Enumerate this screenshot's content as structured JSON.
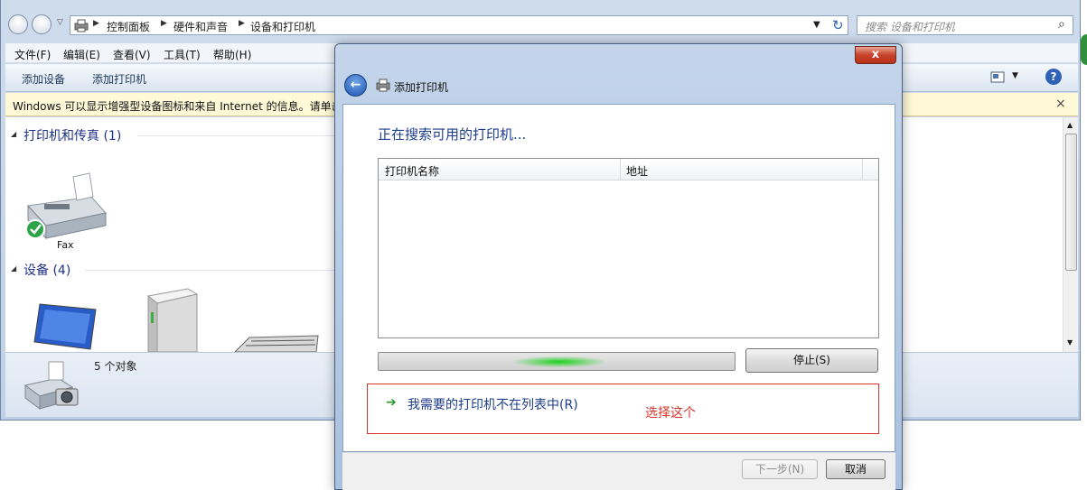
{
  "explorer": {
    "breadcrumbs": [
      "控制面板",
      "硬件和声音",
      "设备和打印机"
    ],
    "search_placeholder": "搜索 设备和打印机",
    "menu": [
      "文件(F)",
      "编辑(E)",
      "查看(V)",
      "工具(T)",
      "帮助(H)"
    ],
    "toolbar": {
      "add_device": "添加设备",
      "add_printer": "添加打印机"
    },
    "infobar": "Windows 可以显示增强型设备图标和来自 Internet 的信息。请单击",
    "groups": {
      "printers": {
        "title": "打印机和传真 (1)",
        "items": [
          "Fax"
        ]
      },
      "devices": {
        "title": "设备 (4)"
      }
    },
    "details": {
      "count": "5 个对象"
    }
  },
  "dialog": {
    "title": "添加打印机",
    "close": "x",
    "heading": "正在搜索可用的打印机...",
    "columns": [
      "打印机名称",
      "地址"
    ],
    "stop_button": "停止(S)",
    "not_listed": "我需要的打印机不在列表中(R)",
    "annotation": "选择这个",
    "next_button": "下一步(N)",
    "cancel_button": "取消"
  },
  "colors": {
    "link": "#1e3d8b",
    "annotation_red": "#d7342c",
    "progress_green": "#19d219"
  }
}
